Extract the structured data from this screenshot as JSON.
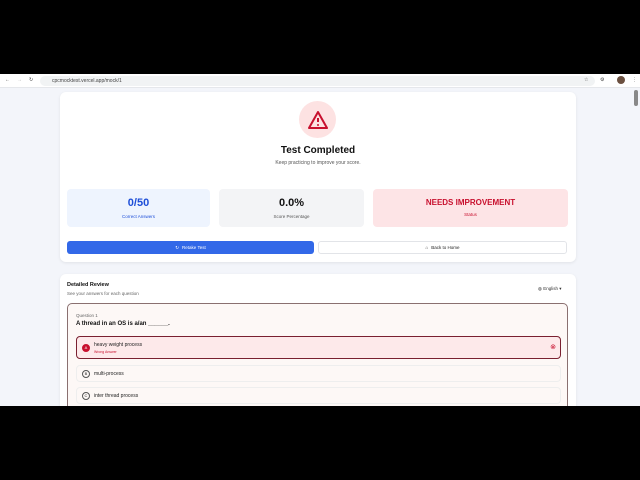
{
  "browser": {
    "url": "cpcmocktest.vercel.app/mock/1"
  },
  "result": {
    "title": "Test Completed",
    "subtitle": "Keep practicing to improve your score.",
    "stats": [
      {
        "value": "0/50",
        "label": "Correct Answers"
      },
      {
        "value": "0.0%",
        "label": "Score Percentage"
      },
      {
        "value": "NEEDS IMPROVEMENT",
        "label": "Status"
      }
    ],
    "retake_label": "Retake Test",
    "home_label": "Back to Home"
  },
  "review": {
    "title": "Detailed Review",
    "subtitle": "See your answers for each question",
    "language": "English",
    "question": {
      "number": "Question 1",
      "text": "A thread in an OS is a/an ______.",
      "options": [
        {
          "letter": "A",
          "text": "heavy weight process",
          "note": "Wrong Answer"
        },
        {
          "letter": "B",
          "text": "multi-process"
        },
        {
          "letter": "C",
          "text": "inter thread process"
        }
      ]
    }
  },
  "colors": {
    "accent": "#3268e8",
    "danger": "#c8102e"
  }
}
